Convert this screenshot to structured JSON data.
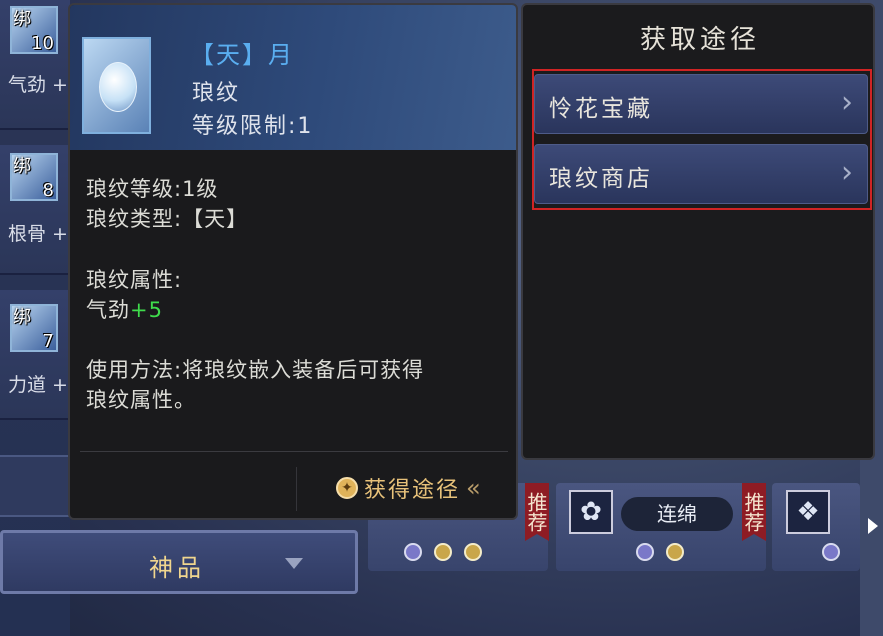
{
  "inventory": {
    "items": [
      {
        "bind": "绑",
        "qty": "10",
        "stat": "气劲 +"
      },
      {
        "bind": "绑",
        "qty": "8",
        "stat": "根骨 +"
      },
      {
        "bind": "绑",
        "qty": "7",
        "stat": "力道 +"
      }
    ],
    "grade_filter": "神品"
  },
  "tooltip": {
    "title": "【天】月",
    "item_type": "琅纹",
    "level_limit": "等级限制:1",
    "grade_line": "琅纹等级:1级",
    "type_line": "琅纹类型:【天】",
    "attr_header": "琅纹属性:",
    "attr_name": "气劲",
    "attr_value": "+5",
    "usage_line1": "使用方法:将琅纹嵌入装备后可获得",
    "usage_line2": "琅纹属性。",
    "obtain_label": "获得途径",
    "obtain_chevron": "«"
  },
  "acquisition": {
    "title": "获取途径",
    "routes": [
      {
        "label": "怜花宝藏",
        "chevron": "›"
      },
      {
        "label": "琅纹商店",
        "chevron": "›"
      }
    ],
    "highlight_color": "#d02424"
  },
  "skills": {
    "recommend": "推荐",
    "skill_name": "连绵"
  },
  "colors": {
    "title_blue": "#5aaef0",
    "attr_green": "#3fdc4c",
    "obtain_gold": "#e8c27a",
    "grade_gold": "#f0d68e"
  }
}
